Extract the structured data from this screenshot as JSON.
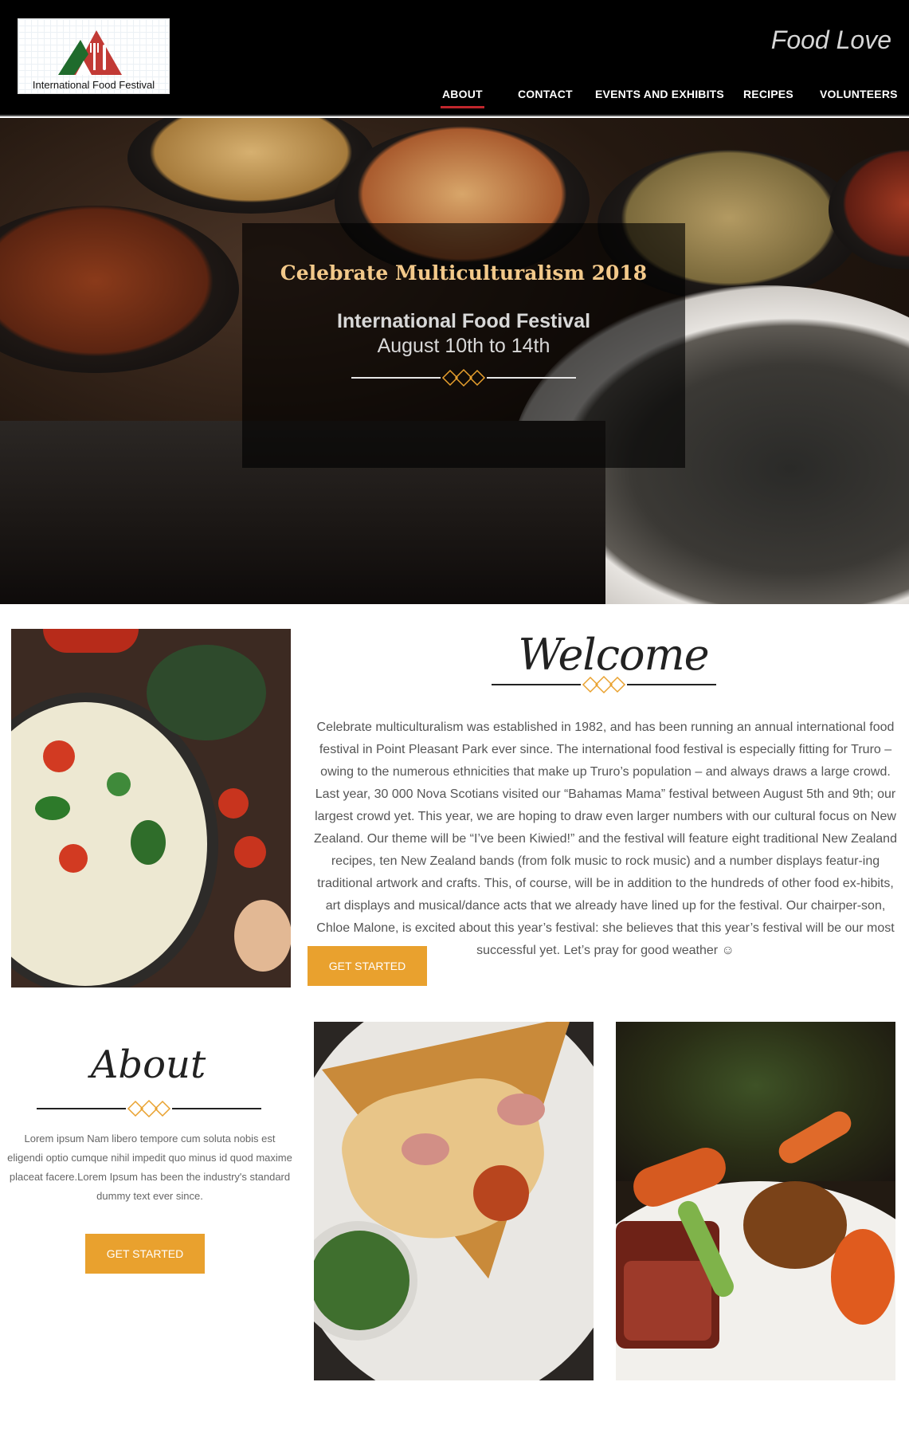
{
  "header": {
    "logo_text": "International Food Festival",
    "site_title": "Food Love",
    "nav": [
      {
        "label": "ABOUT",
        "active": true
      },
      {
        "label": "CONTACT",
        "active": false
      },
      {
        "label": "EVENTS AND EXHIBITS",
        "active": false
      },
      {
        "label": "RECIPES",
        "active": false
      },
      {
        "label": "VOLUNTEERS",
        "active": false
      }
    ]
  },
  "hero": {
    "heading": "Celebrate Multiculturalism 2018",
    "subtitle": "International Food Festival",
    "date": "August 10th to 14th"
  },
  "welcome": {
    "title": "Welcome",
    "body": "Celebrate multiculturalism was established in 1982, and has been running an annual international food festival in Point Pleasant Park ever since.  The international food festival is especially fitting for Truro – owing to the numerous ethnicities that make up Truro’s population – and always draws a large crowd.  Last year, 30 000 Nova Scotians visited our “Bahamas Mama” festival between August 5th and 9th; our largest crowd yet.  This year, we are hoping to draw even larger numbers with our cultural focus on New Zealand.  Our theme will be “I’ve been Kiwied!” and the festival will feature eight traditional New Zealand recipes, ten New Zealand bands (from folk music to rock music) and a number displays featur-ing traditional artwork and crafts.  This, of course, will be in addition to the hundreds of other food ex-hibits, art displays and musical/dance acts that we already have lined up for the festival.  Our chairper-son, Chloe Malone, is excited about this year’s festival: she believes that this year’s festival will be our most successful yet.  Let’s pray for good weather ☺",
    "button": "GET STARTED"
  },
  "about": {
    "title": "About",
    "body": "Lorem ipsum Nam libero tempore cum soluta nobis est eligendi optio cumque nihil impedit quo minus id quod maxime placeat facere.Lorem Ipsum has been the industry's standard dummy text ever since.",
    "button": "GET STARTED"
  },
  "colors": {
    "accent_orange": "#e9a12e",
    "nav_underline": "#c0262c",
    "hero_heading": "#f3c98a"
  }
}
